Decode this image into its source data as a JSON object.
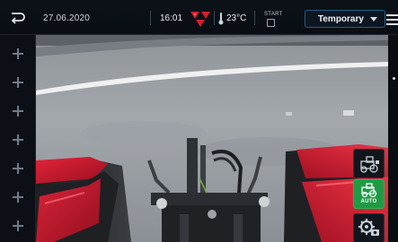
{
  "status_bar": {
    "date": "27.06.2020",
    "time": "16:01",
    "temperature": "23°C",
    "start_label": "START",
    "mode": "Temporary"
  },
  "left_panel": {
    "plus_buttons": 7
  },
  "controls": {
    "auto_label": "AUTO"
  },
  "colors": {
    "accent_blue": "#1e5e8b",
    "auto_green": "#1f9a45",
    "brand_red": "#d41f2a",
    "tractor_red": "#c8142a"
  },
  "icons": {
    "back": "back-arrow-icon",
    "logo": "brand-triangles-icon",
    "menu": "hamburger-menu-icon",
    "tractor": "tractor-icon",
    "gear": "gear-icon"
  }
}
